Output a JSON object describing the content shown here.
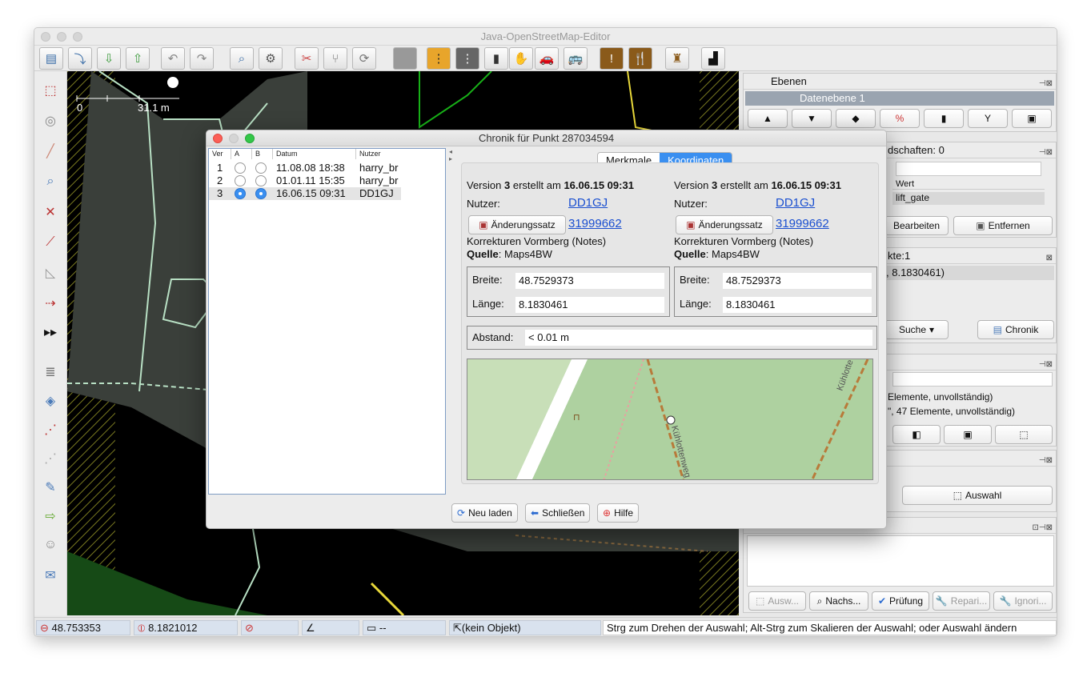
{
  "app": {
    "title": "Java-OpenStreetMap-Editor"
  },
  "map": {
    "scale_zero": "0",
    "scale_label": "31.1 m"
  },
  "panels": {
    "layers": {
      "title": "Ebenen",
      "layer_name": "Datenebene 1"
    },
    "properties": {
      "title_partial": "dschaften: 0",
      "col_value": "Wert",
      "row_value": "lift_gate",
      "edit_button": "Bearbeiten",
      "remove_button": "Entfernen"
    },
    "selection": {
      "title_partial": "kte:1",
      "value_partial": ", 8.1830461)",
      "search_button": "Suche",
      "history_button": "Chronik"
    },
    "relations": {
      "line1": "Elemente, unvollständig)",
      "line2": "\", 47 Elemente, unvollständig)"
    },
    "select": {
      "select_button": "Auswahl"
    },
    "validator": {
      "buttons": [
        "Ausw...",
        "Nachs...",
        "Prüfung",
        "Repari...",
        "Ignori..."
      ]
    }
  },
  "status": {
    "lat": "48.753353",
    "lon": "8.1821012",
    "dist": "--",
    "object": "(kein Objekt)",
    "help": "Strg zum Drehen der Auswahl; Alt-Strg zum Skalieren der Auswahl; oder Auswahl ändern"
  },
  "dialog": {
    "title": "Chronik für Punkt 287034594",
    "table": {
      "headers": [
        "Ver",
        "A",
        "B",
        "Datum",
        "Nutzer"
      ],
      "rows": [
        {
          "ver": "1",
          "date": "11.08.08 18:38",
          "user": "harry_br",
          "a": false,
          "b": false
        },
        {
          "ver": "2",
          "date": "01.01.11 15:35",
          "user": "harry_br",
          "a": false,
          "b": false
        },
        {
          "ver": "3",
          "date": "16.06.15 09:31",
          "user": "DD1GJ",
          "a": true,
          "b": true
        }
      ]
    },
    "tabs": [
      "Merkmale",
      "Koordinaten"
    ],
    "active_tab": "Koordinaten",
    "left": {
      "version_prefix": "Version",
      "version": "3",
      "created": "erstellt am",
      "date": "16.06.15 09:31",
      "user_label": "Nutzer:",
      "user": "DD1GJ",
      "changeset_button": "Änderungssatz",
      "changeset": "31999662",
      "comment": "Korrekturen Vormberg (Notes)",
      "source_label": "Quelle",
      "source": "Maps4BW",
      "lat_label": "Breite:",
      "lat": "48.7529373",
      "lon_label": "Länge:",
      "lon": "8.1830461"
    },
    "right": {
      "version_prefix": "Version",
      "version": "3",
      "created": "erstellt am",
      "date": "16.06.15 09:31",
      "user_label": "Nutzer:",
      "user": "DD1GJ",
      "changeset_button": "Änderungssatz",
      "changeset": "31999662",
      "comment": "Korrekturen Vormberg (Notes)",
      "source_label": "Quelle",
      "source": "Maps4BW",
      "lat_label": "Breite:",
      "lat": "48.7529373",
      "lon_label": "Länge:",
      "lon": "8.1830461"
    },
    "distance_label": "Abstand:",
    "distance": "< 0.01 m",
    "minimap": {
      "street1": "Kühlottenweg",
      "street2": "Kühlotte"
    },
    "buttons": {
      "reload": "Neu laden",
      "close": "Schließen",
      "help": "Hilfe"
    }
  }
}
